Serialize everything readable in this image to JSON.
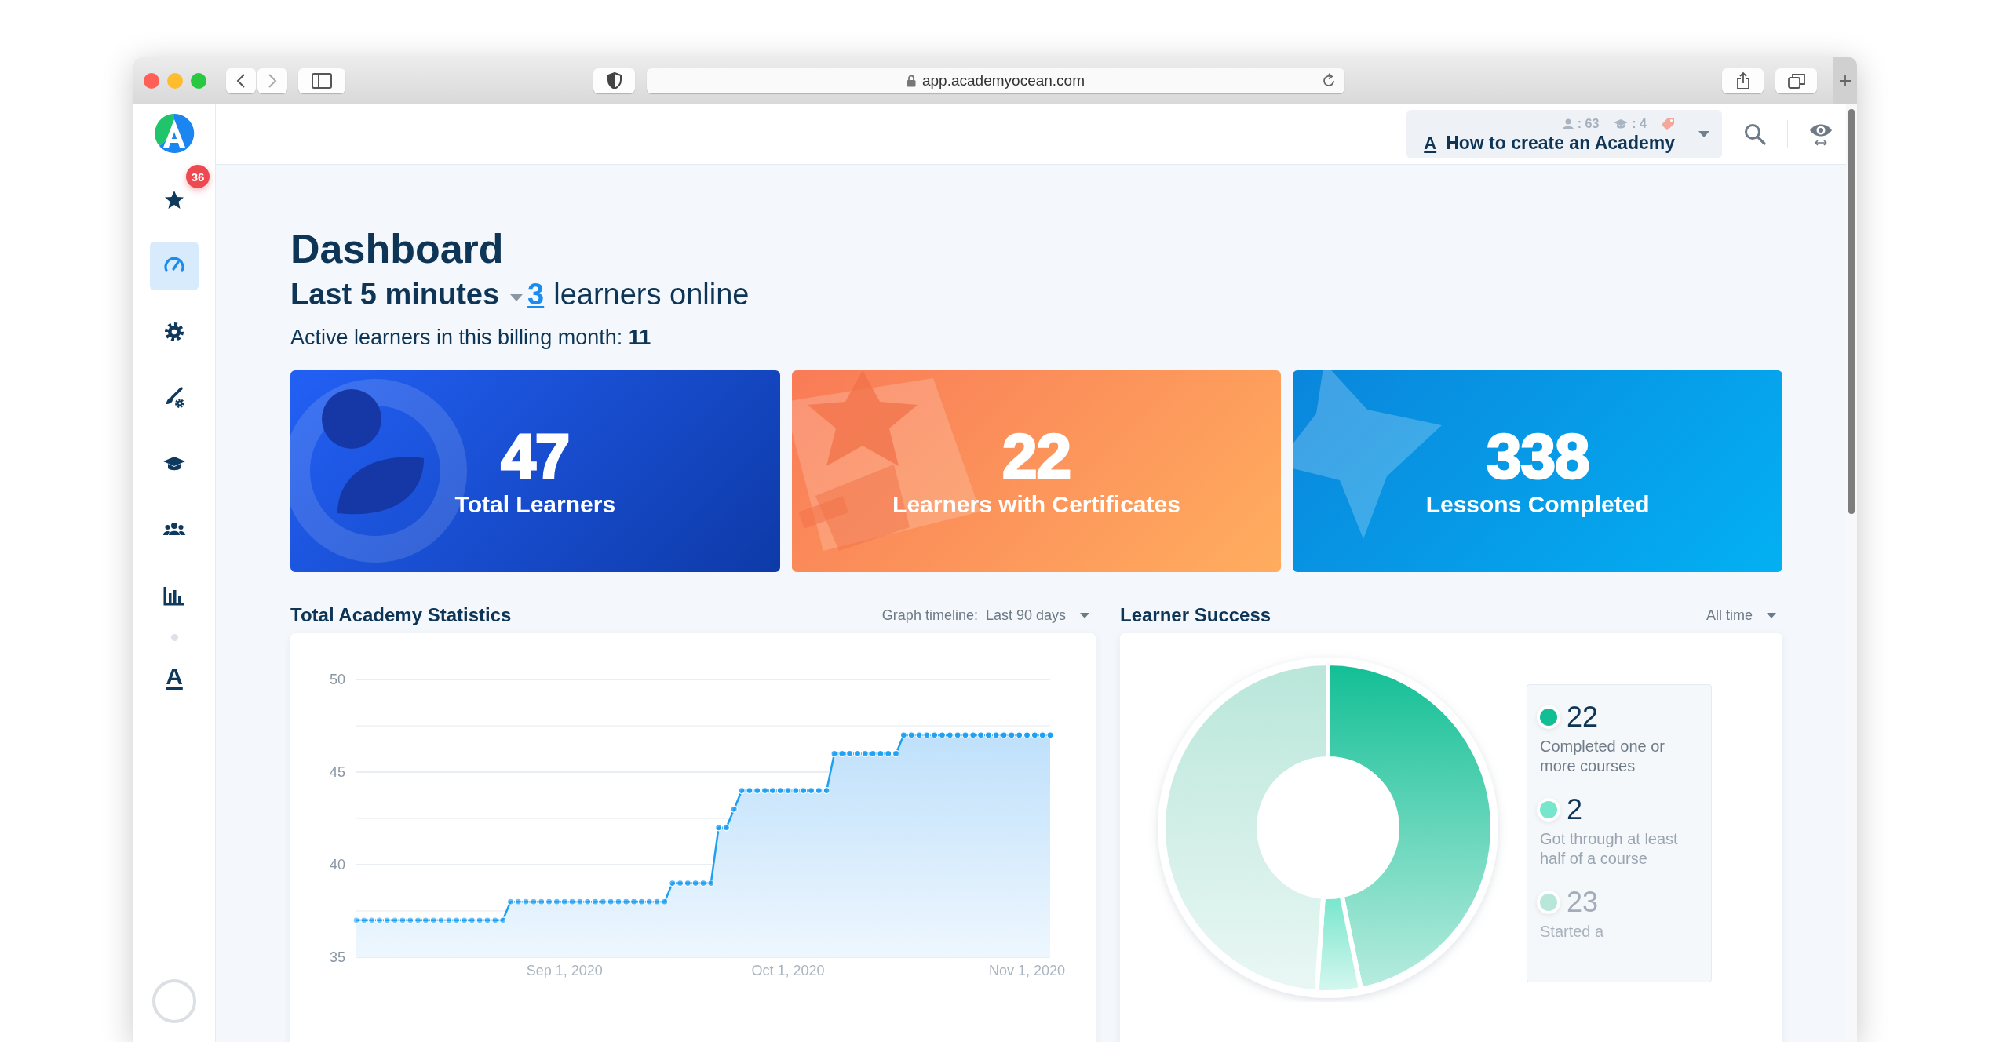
{
  "browser": {
    "url": "app.academyocean.com"
  },
  "sidebar": {
    "items": [
      {
        "kind": "star",
        "badge": "36",
        "selected": false
      },
      {
        "kind": "gauge",
        "selected": true
      },
      {
        "kind": "gear",
        "selected": false
      },
      {
        "kind": "brush",
        "selected": false
      },
      {
        "kind": "cap",
        "selected": false
      },
      {
        "kind": "users",
        "selected": false
      },
      {
        "kind": "chart",
        "selected": false
      }
    ],
    "more_items": [
      {
        "glyph": "A",
        "selected": false
      }
    ]
  },
  "header": {
    "academy": {
      "glyph": "A",
      "title": "How to create an Academy",
      "learners": ": 63",
      "courses": ": 4"
    }
  },
  "dashboard": {
    "title": "Dashboard",
    "period": "Last 5 minutes",
    "online_count": "3",
    "online_text": "learners online",
    "billing": "Active learners in this billing month: **11**"
  },
  "stat_cards": [
    {
      "kind": "learners",
      "value": "47",
      "label": "Total Learners"
    },
    {
      "kind": "certificates",
      "value": "22",
      "label": "Learners with Certificates"
    },
    {
      "kind": "lessons",
      "value": "338",
      "label": "Lessons Completed"
    }
  ],
  "statistics": {
    "title": "Total Academy Statistics",
    "timeline_label": "Graph timeline:",
    "timeline_value": "Last 90 days",
    "chart_data": {
      "type": "area",
      "categories": [
        null,
        null,
        null,
        null,
        null,
        null,
        null,
        null,
        null,
        null,
        null,
        null,
        null,
        null,
        null,
        null,
        null,
        null,
        null,
        null,
        null,
        null,
        null,
        null,
        null,
        null,
        null,
        "Sep 1, 2020",
        null,
        null,
        null,
        null,
        null,
        null,
        null,
        null,
        null,
        null,
        null,
        null,
        null,
        null,
        null,
        null,
        null,
        null,
        null,
        null,
        null,
        null,
        null,
        null,
        null,
        null,
        null,
        null,
        "Oct 1, 2020",
        null,
        null,
        null,
        null,
        null,
        null,
        null,
        null,
        null,
        null,
        null,
        null,
        null,
        null,
        null,
        null,
        null,
        null,
        null,
        null,
        null,
        null,
        null,
        null,
        null,
        null,
        null,
        null,
        null,
        null,
        "Nov 1, 2020",
        null,
        null,
        null
      ],
      "series": [
        {
          "color": "#1e9ff2",
          "marker": true,
          "values": [
            37,
            37,
            37,
            37,
            37,
            37,
            37,
            37,
            37,
            37,
            37,
            37,
            37,
            37,
            37,
            37,
            37,
            37,
            37,
            37,
            38,
            38,
            38,
            38,
            38,
            38,
            38,
            38,
            38,
            38,
            38,
            38,
            38,
            38,
            38,
            38,
            38,
            38,
            38,
            38,
            38,
            39,
            39,
            39,
            39,
            39,
            39,
            42,
            42,
            43,
            44,
            44,
            44,
            44,
            44,
            44,
            44,
            44,
            44,
            44,
            44,
            44,
            46,
            46,
            46,
            46,
            46,
            46,
            46,
            46,
            46,
            47,
            47,
            47,
            47,
            47,
            47,
            47,
            47,
            47,
            47,
            47,
            47,
            47,
            47,
            47,
            47,
            47,
            47,
            47,
            47
          ]
        }
      ],
      "ylim": [
        35,
        50
      ],
      "yticks": [
        35,
        40,
        45,
        50
      ]
    }
  },
  "success": {
    "title": "Learner Success",
    "period": "All time",
    "chart_data": {
      "type": "donut",
      "values": [
        46.8,
        4.3,
        48.9
      ]
    },
    "legend": [
      {
        "value": "22",
        "label": "Completed one or more courses",
        "color": "#12bf95"
      },
      {
        "value": "2",
        "label": "Got through at least half of a course",
        "color": "#76e6cc"
      },
      {
        "value": "23",
        "label": "Started a",
        "color": "#b9e6da"
      }
    ]
  }
}
